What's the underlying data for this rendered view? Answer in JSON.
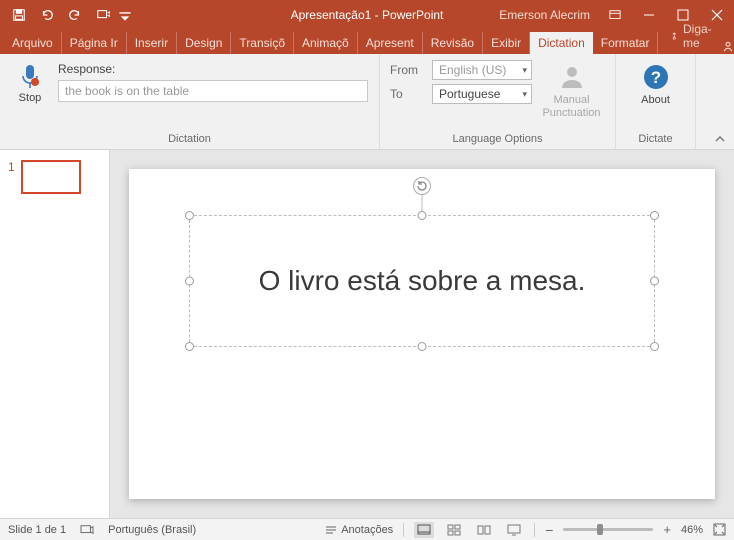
{
  "title": {
    "doc": "Apresentação1",
    "app": "PowerPoint"
  },
  "user": "Emerson Alecrim",
  "tabs": [
    "Arquivo",
    "Página Ir",
    "Inserir",
    "Design",
    "Transiçõ",
    "Animaçõ",
    "Apresent",
    "Revisão",
    "Exibir",
    "Dictation",
    "Formatar"
  ],
  "active_tab_index": 9,
  "tellme": "Diga-me",
  "ribbon": {
    "stop": "Stop",
    "response_label": "Response:",
    "response_value": "the book is on the table",
    "group_dictation": "Dictation",
    "from_label": "From",
    "to_label": "To",
    "from_value": "English (US)",
    "to_value": "Portuguese",
    "manual_punctuation": "Manual Punctuation",
    "about": "About",
    "group_lang": "Language Options",
    "group_dictate": "Dictate"
  },
  "thumbnail": {
    "number": "1"
  },
  "slide_text": "O livro está sobre a mesa.",
  "status": {
    "slide_pos": "Slide 1 de 1",
    "language": "Português (Brasil)",
    "notes": "Anotações",
    "zoom": "46%"
  }
}
